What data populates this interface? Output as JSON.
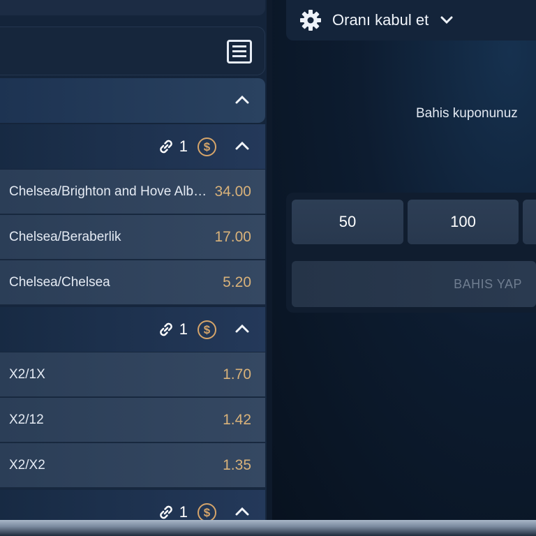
{
  "left_panel": {
    "groups": [
      {
        "count": "1",
        "rows": [
          {
            "name": "Chelsea/Brighton and Hove Albion",
            "odds": "34.00"
          },
          {
            "name": "Chelsea/Beraberlik",
            "odds": "17.00"
          },
          {
            "name": "Chelsea/Chelsea",
            "odds": "5.20"
          }
        ]
      },
      {
        "count": "1",
        "rows": [
          {
            "name": "X2/1X",
            "odds": "1.70"
          },
          {
            "name": "X2/12",
            "odds": "1.42"
          },
          {
            "name": "X2/X2",
            "odds": "1.35"
          }
        ]
      },
      {
        "count": "1",
        "rows": []
      }
    ],
    "coin_symbol": "$"
  },
  "right_panel": {
    "accept_odds_label": "Oranı kabul et",
    "coupon_message": "Bahis kuponunuz",
    "stakes": [
      "50",
      "100"
    ],
    "place_bet_label": "BAHIS YAP"
  },
  "colors": {
    "odds": "#d9b27a",
    "coin": "#d6a56a",
    "background": "#0b1626"
  }
}
